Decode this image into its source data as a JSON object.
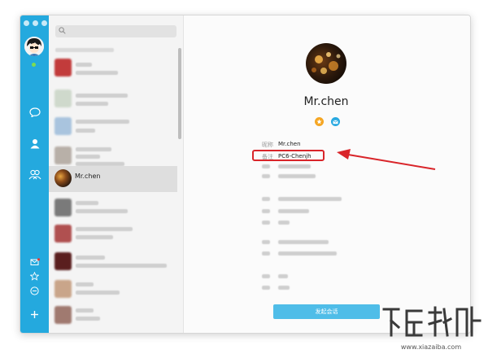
{
  "contact": {
    "display_name": "Mr.chen",
    "nickname_label": "昵称",
    "nickname_value": "Mr.chen",
    "remark_label": "备注",
    "remark_value": "PC6-Chenjh"
  },
  "contact_list": {
    "selected_name": "Mr.chen"
  },
  "actions": {
    "start_chat": "发起会话"
  },
  "icons": {
    "sidebar": [
      "chat-icon",
      "contacts-icon",
      "groups-icon",
      "mail-icon",
      "star-icon",
      "minus-icon",
      "add-icon"
    ],
    "profile_badges": [
      "star-badge-icon",
      "mail-badge-icon"
    ]
  },
  "colors": {
    "sidebar": "#24a9de",
    "highlight": "#d9252a",
    "button": "#4fbde8"
  },
  "watermark": {
    "domain": "www.xiazaiba.com"
  }
}
